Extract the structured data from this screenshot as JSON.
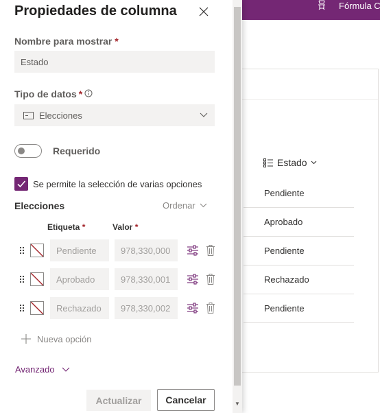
{
  "background": {
    "topbar_text": "Fórmula C",
    "topbar_color": "#742774",
    "column_header": "Estado",
    "rows": [
      "Pendiente",
      "Aprobado",
      "Pendiente",
      "Rechazado",
      "Pendiente"
    ]
  },
  "panel": {
    "title": "Propiedades de columna",
    "display_name": {
      "label": "Nombre para mostrar",
      "required_mark": "*",
      "placeholder": "Estado"
    },
    "data_type": {
      "label": "Tipo de datos",
      "required_mark": "*",
      "value": "Elecciones"
    },
    "required_toggle": {
      "label": "Requerido",
      "on": false
    },
    "multi_select": {
      "label": "Se permite la selección de varias opciones",
      "checked": true
    },
    "choices": {
      "title": "Elecciones",
      "sort_label": "Ordenar",
      "column_label": "Etiqueta",
      "column_value": "Valor",
      "required_mark": "*",
      "options": [
        {
          "label": "Pendiente",
          "value": "978,330,000"
        },
        {
          "label": "Aprobado",
          "value": "978,330,001"
        },
        {
          "label": "Rechazado",
          "value": "978,330,002"
        }
      ],
      "add_label": "Nueva opción"
    },
    "advanced_label": "Avanzado",
    "buttons": {
      "update": "Actualizar",
      "cancel": "Cancelar"
    },
    "accent_color": "#742774"
  }
}
